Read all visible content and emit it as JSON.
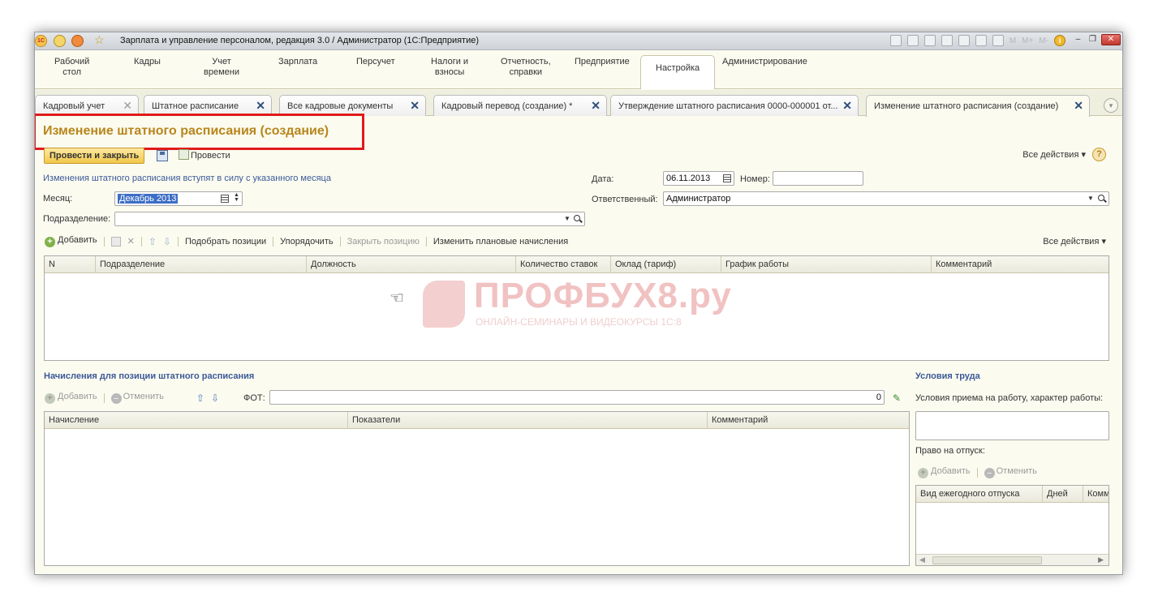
{
  "window": {
    "title": "Зарплата и управление персоналом, редакция 3.0 / Администратор  (1С:Предприятие)",
    "logo_text": "1С",
    "toolbar_memory": [
      "M",
      "M+",
      "M-"
    ],
    "info_glyph": "i"
  },
  "sections": [
    {
      "label": "Рабочий\nстол"
    },
    {
      "label": "Кадры"
    },
    {
      "label": "Учет\nвремени"
    },
    {
      "label": "Зарплата"
    },
    {
      "label": "Персучет"
    },
    {
      "label": "Налоги и\nвзносы"
    },
    {
      "label": "Отчетность,\nсправки"
    },
    {
      "label": "Предприятие"
    },
    {
      "label": "Настройка"
    },
    {
      "label": "Администрирование"
    }
  ],
  "tabs": [
    {
      "label": "Кадровый учет"
    },
    {
      "label": "Штатное расписание"
    },
    {
      "label": "Все кадровые документы"
    },
    {
      "label": "Кадровый перевод (создание) *"
    },
    {
      "label": "Утверждение штатного расписания 0000-000001 от..."
    },
    {
      "label": "Изменение штатного расписания (создание)"
    }
  ],
  "form": {
    "title": "Изменение штатного расписания (создание)",
    "btn_post_close": "Провести и закрыть",
    "btn_post": "Провести",
    "all_actions": "Все действия ▾",
    "help": "?",
    "note": "Изменения штатного расписания вступят в силу с указанного месяца",
    "month_label": "Месяц:",
    "month_value": "Декабрь 2013",
    "dept_label": "Подразделение:",
    "dept_value": "",
    "date_label": "Дата:",
    "date_value": "06.11.2013",
    "number_label": "Номер:",
    "number_value": "",
    "responsible_label": "Ответственный:",
    "responsible_value": "Администратор"
  },
  "positions_toolbar": {
    "add": "Добавить",
    "pick": "Подобрать позиции",
    "sort": "Упорядочить",
    "close_pos": "Закрыть позицию",
    "change_accruals": "Изменить плановые начисления",
    "all_actions": "Все действия ▾"
  },
  "positions_table": {
    "columns": [
      "N",
      "Подразделение",
      "Должность",
      "Количество ставок",
      "Оклад (тариф)",
      "График работы",
      "Комментарий"
    ],
    "rows": []
  },
  "watermark": {
    "title": "ПРОФБУХ8.ру",
    "subtitle": "ОНЛАЙН-СЕМИНАРЫ И ВИДЕОКУРСЫ 1С:8"
  },
  "accruals": {
    "heading": "Начисления для позиции штатного расписания",
    "add": "Добавить",
    "cancel": "Отменить",
    "fot_label": "ФОТ:",
    "fot_value": "0",
    "columns": [
      "Начисление",
      "Показатели",
      "Комментарий"
    ],
    "rows": []
  },
  "conditions": {
    "heading": "Условия труда",
    "hire_label": "Условия приема на работу, характер работы:",
    "hire_value": "",
    "leave_label": "Право на отпуск:",
    "add": "Добавить",
    "cancel": "Отменить",
    "columns": [
      "Вид ежегодного отпуска",
      "Дней",
      "Комм"
    ],
    "rows": []
  }
}
